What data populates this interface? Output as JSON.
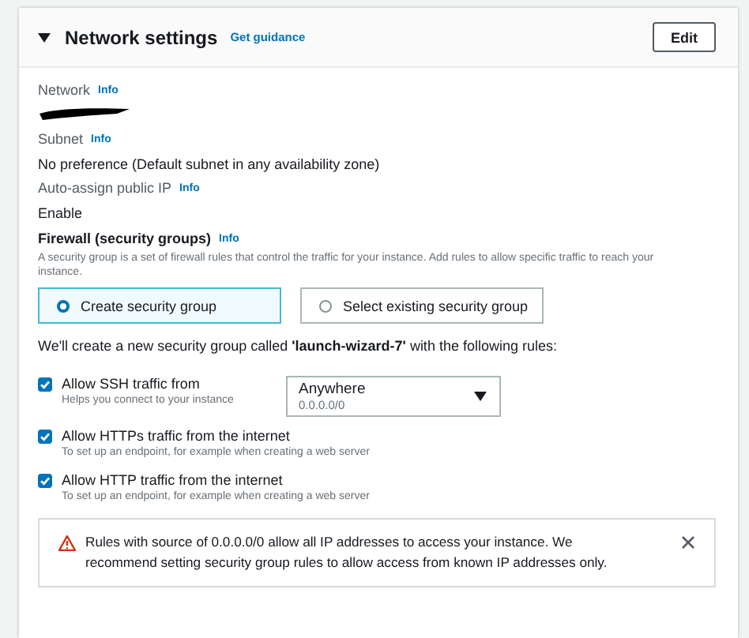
{
  "section": {
    "title": "Network settings",
    "expanded": true,
    "guidance_link": "Get guidance",
    "edit_button": "Edit"
  },
  "fields": [
    {
      "label": "Network",
      "info": "Info",
      "redacted": true
    },
    {
      "label": "Subnet",
      "info": "Info",
      "value": "No preference (Default subnet in any availability zone)"
    },
    {
      "label": "Auto-assign public IP",
      "info": "Info",
      "value": "Enable"
    }
  ],
  "firewall": {
    "label": "Firewall (security groups)",
    "info": "Info",
    "description": "A security group is a set of firewall rules that control the traffic for your instance. Add rules to allow specific traffic to reach your instance.",
    "options": [
      {
        "label": "Create security group",
        "selected": true
      },
      {
        "label": "Select existing security group",
        "selected": false
      }
    ],
    "summary": "We'll create a new security group called **'launch-wizard-7'** with the following rules:",
    "rules": [
      {
        "label": "Allow SSH traffic from",
        "hint": "Helps you connect to your instance",
        "checked": true,
        "source": {
          "value": "Anywhere",
          "detail": "0.0.0.0/0"
        }
      },
      {
        "label": "Allow HTTPs traffic from the internet",
        "hint": "To set up an endpoint, for example when creating a web server",
        "checked": true
      },
      {
        "label": "Allow HTTP traffic from the internet",
        "hint": "To set up an endpoint, for example when creating a web server",
        "checked": true
      }
    ]
  },
  "alert": {
    "kind": "warning",
    "message": "Rules with source of 0.0.0.0/0 allow all IP addresses to access your instance. We recommend setting security group rules to allow access from known IP addresses only.",
    "dismissible": true
  }
}
